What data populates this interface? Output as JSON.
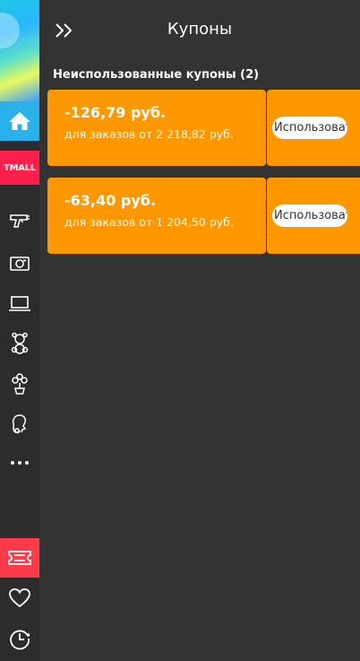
{
  "header": {
    "title": "Купоны"
  },
  "sidebar": {
    "tmall_label": "TMALL",
    "items": [
      {
        "icon": "home-icon"
      },
      {
        "icon": "tools-icon"
      },
      {
        "icon": "camera-icon"
      },
      {
        "icon": "laptop-icon"
      },
      {
        "icon": "toy-icon"
      },
      {
        "icon": "plant-icon"
      },
      {
        "icon": "beauty-icon"
      },
      {
        "icon": "more-icon"
      },
      {
        "icon": "coupon-icon"
      },
      {
        "icon": "heart-icon"
      },
      {
        "icon": "history-icon"
      }
    ]
  },
  "section": {
    "title": "Неиспользованные купоны (2)"
  },
  "coupons": [
    {
      "amount": "-126,79 руб.",
      "condition": "для заказов от 2 218,82 руб.",
      "button": "Использовать"
    },
    {
      "amount": "-63,40 руб.",
      "condition": "для заказов от 1 204,50 руб.",
      "button": "Использовать"
    }
  ],
  "colors": {
    "accent": "#ff9800",
    "home": "#2ab0ea",
    "tmall": "#ff1f4a",
    "coupon_tab": "#ff3b4a",
    "background": "#333333"
  }
}
